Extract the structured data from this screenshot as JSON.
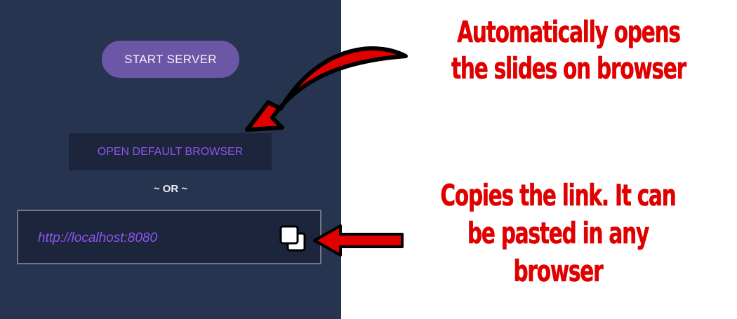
{
  "panel": {
    "start_button": "START SERVER",
    "open_browser_button": "OPEN DEFAULT BROWSER",
    "or_separator": "~ OR ~",
    "url": "http://localhost:8080"
  },
  "annotations": {
    "open_browser_note_line1": "Automatically opens",
    "open_browser_note_line2": "the slides on browser",
    "copy_note_line1": "Copies the link. It can",
    "copy_note_line2": "be pasted in any",
    "copy_note_line3": "browser"
  },
  "icons": {
    "copy": "copy-icon",
    "arrows": "red-arrow"
  },
  "colors": {
    "panel_bg": "#27344f",
    "start_button_bg": "#6b57a6",
    "accent_purple": "#8e55f2",
    "annotation_red": "#e00000"
  }
}
